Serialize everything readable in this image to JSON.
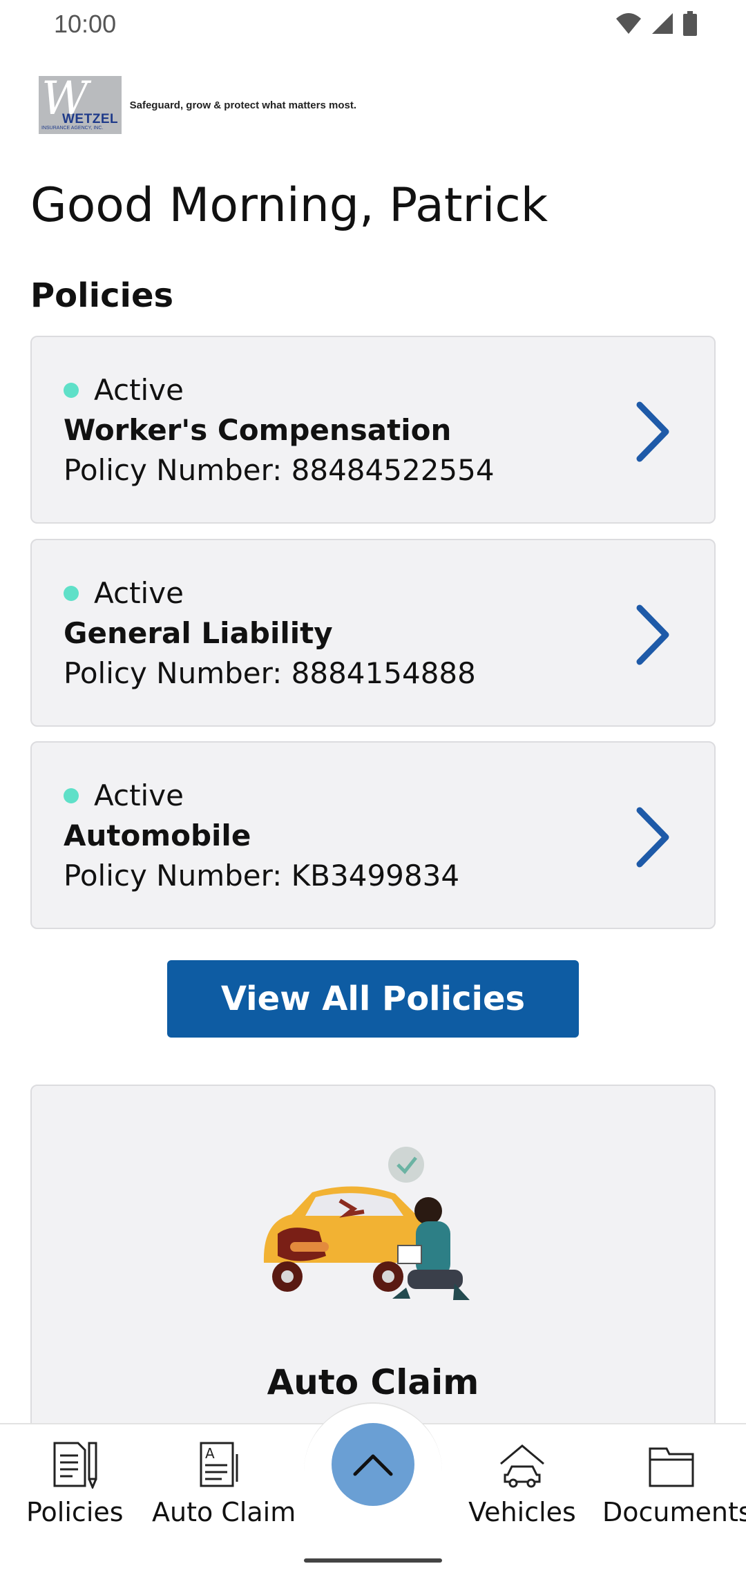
{
  "status_bar": {
    "time": "10:00"
  },
  "logo": {
    "name": "WETZEL",
    "subtitle": "INSURANCE AGENCY, INC.",
    "tagline": "Safeguard, grow & protect what matters most."
  },
  "greeting": "Good Morning, Patrick",
  "policies_section": {
    "title": "Policies",
    "items": [
      {
        "status": "Active",
        "name": "Worker's Compensation",
        "number": "Policy Number: 88484522554"
      },
      {
        "status": "Active",
        "name": "General Liability",
        "number": "Policy Number: 8884154888"
      },
      {
        "status": "Active",
        "name": "Automobile",
        "number": "Policy Number: KB3499834"
      }
    ],
    "view_all_label": "View All Policies"
  },
  "claim_card": {
    "title": "Auto Claim"
  },
  "bottom_nav": {
    "items": [
      {
        "label": "Policies",
        "icon": "policies-icon"
      },
      {
        "label": "Auto Claim",
        "icon": "auto-claim-icon"
      },
      {
        "label": "Vehicles",
        "icon": "vehicles-icon"
      },
      {
        "label": "Documents",
        "icon": "documents-icon"
      }
    ],
    "fab_icon": "chevron-up-icon"
  },
  "colors": {
    "primary": "#0e5ca3",
    "status_active": "#5fe0c8",
    "chevron": "#1e5aa8",
    "fab": "#6a9fd4"
  }
}
